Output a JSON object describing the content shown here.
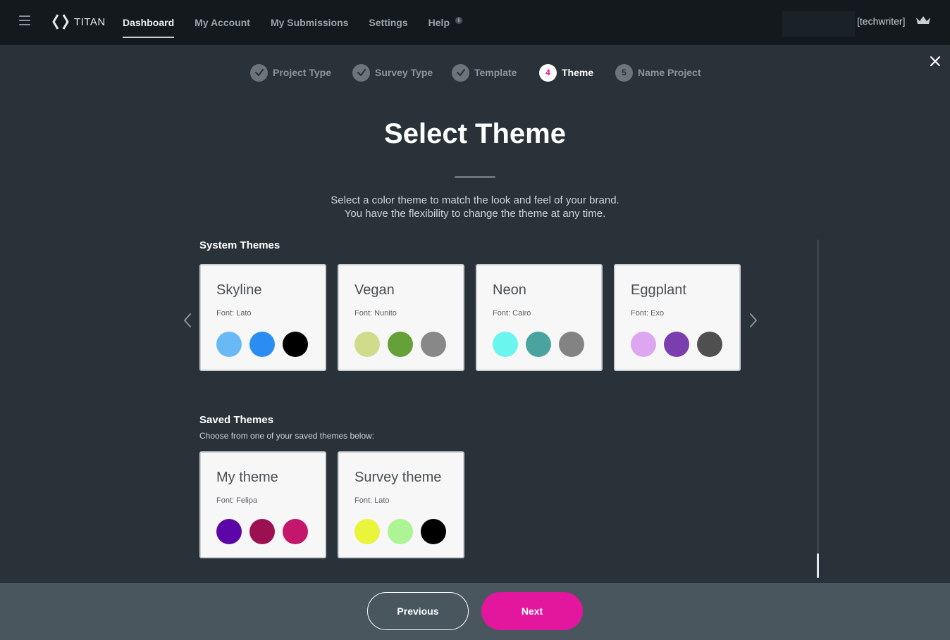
{
  "nav": {
    "brand": "TITAN",
    "links": [
      {
        "label": "Dashboard"
      },
      {
        "label": "My Account"
      },
      {
        "label": "My Submissions"
      },
      {
        "label": "Settings"
      },
      {
        "label": "Help"
      }
    ],
    "help_badge": "i",
    "user": "[techwriter]"
  },
  "steps": [
    {
      "label": "Project Type",
      "state": "done"
    },
    {
      "label": "Survey Type",
      "state": "done"
    },
    {
      "label": "Template",
      "state": "done"
    },
    {
      "label": "Theme",
      "number": "4",
      "state": "current"
    },
    {
      "label": "Name Project",
      "number": "5",
      "state": "upcoming"
    }
  ],
  "page": {
    "title": "Select Theme",
    "subtitle_line1": "Select a color theme to match the look and feel of your brand.",
    "subtitle_line2": "You have the flexibility to change the theme at any time."
  },
  "system_themes": {
    "heading": "System Themes",
    "items": [
      {
        "name": "Skyline",
        "font": "Font: Lato",
        "colors": [
          "#6ab9f7",
          "#2b8cf2",
          "#000000"
        ]
      },
      {
        "name": "Vegan",
        "font": "Font: Nunito",
        "colors": [
          "#d1db8c",
          "#66a038",
          "#888888"
        ]
      },
      {
        "name": "Neon",
        "font": "Font: Cairo",
        "colors": [
          "#6af5ee",
          "#4aa39f",
          "#838383"
        ]
      },
      {
        "name": "Eggplant",
        "font": "Font: Exo",
        "colors": [
          "#dca6f0",
          "#7a3fad",
          "#4f4f4f"
        ]
      }
    ]
  },
  "saved_themes": {
    "heading": "Saved Themes",
    "description": "Choose from one of your saved themes below:",
    "items": [
      {
        "name": "My theme",
        "font": "Font: Felipa",
        "colors": [
          "#5c06a8",
          "#9c0f50",
          "#c4166a"
        ]
      },
      {
        "name": "Survey theme",
        "font": "Font: Lato",
        "colors": [
          "#e8f53a",
          "#adf594",
          "#000000"
        ]
      }
    ]
  },
  "footer": {
    "previous_label": "Previous",
    "next_label": "Next"
  },
  "colors": {
    "accent": "#e2179e",
    "background": "#283238",
    "topbar": "#14191d",
    "footer": "#4a565e"
  }
}
